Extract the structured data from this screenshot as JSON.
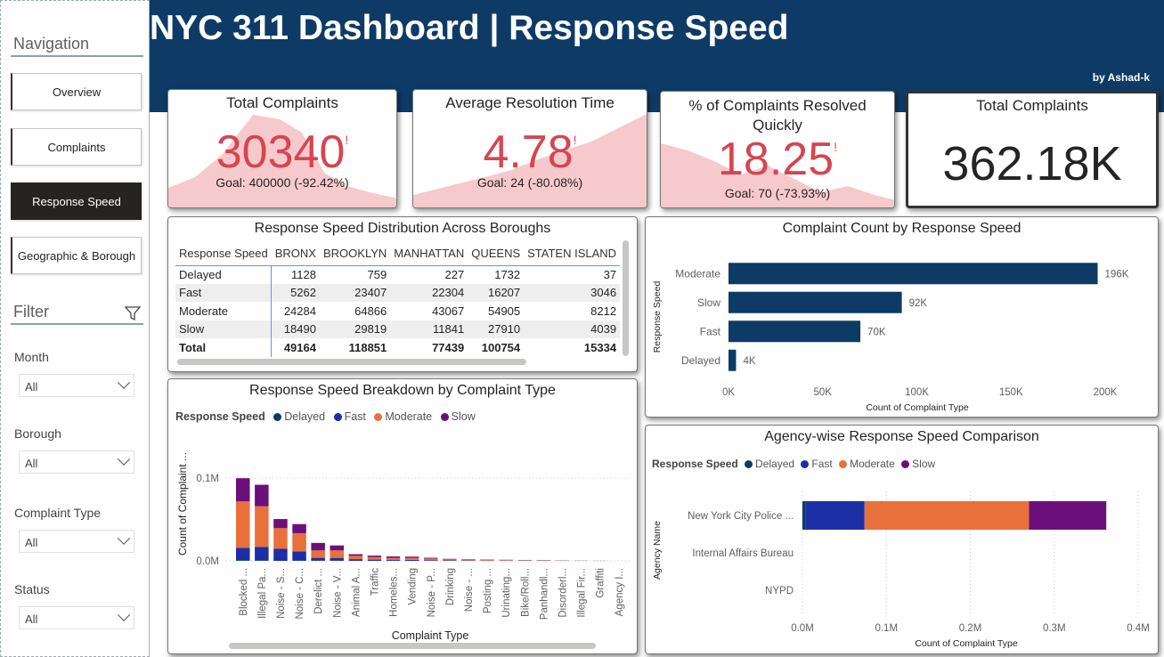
{
  "header": {
    "title": "NYC 311 Dashboard | Response Speed",
    "byline": "by Ashad-k"
  },
  "sidebar": {
    "navigation_heading": "Navigation",
    "nav_items": [
      {
        "label": "Overview",
        "active": false
      },
      {
        "label": "Complaints",
        "active": false
      },
      {
        "label": "Response Speed",
        "active": true
      },
      {
        "label": "Geographic & Borough",
        "active": false
      }
    ],
    "filter_heading": "Filter",
    "filters": [
      {
        "label": "Month",
        "value": "All"
      },
      {
        "label": "Borough",
        "value": "All"
      },
      {
        "label": "Complaint Type",
        "value": "All"
      },
      {
        "label": "Status",
        "value": "All"
      }
    ]
  },
  "kpis": [
    {
      "title": "Total Complaints",
      "value": "30340",
      "indicator": "!",
      "goal": "Goal: 400000 (-92.42%)"
    },
    {
      "title": "Average Resolution Time",
      "value": "4.78",
      "indicator": "!",
      "goal": "Goal: 24 (-80.08%)"
    },
    {
      "title": "% of Complaints Resolved Quickly",
      "value": "18.25",
      "indicator": "!",
      "goal": "Goal: 70 (-73.93%)"
    },
    {
      "title": "Total Complaints",
      "value": "362.18K"
    }
  ],
  "colors": {
    "header_bg": "#0d3b66",
    "kpi_value": "#d64550",
    "spark_fill": "#f6c9cc",
    "bar_navy": "#0d3b66",
    "delayed": "#0d3b66",
    "fast": "#1c2fa6",
    "moderate": "#e8703a",
    "slow": "#6b0f7a"
  },
  "matrix": {
    "title": "Response Speed Distribution Across Boroughs",
    "columns": [
      "Response Speed",
      "BRONX",
      "BROOKLYN",
      "MANHATTAN",
      "QUEENS",
      "STATEN ISLAND"
    ],
    "rows": [
      [
        "Delayed",
        "1128",
        "759",
        "227",
        "1732",
        "37"
      ],
      [
        "Fast",
        "5262",
        "23407",
        "22304",
        "16207",
        "3046"
      ],
      [
        "Moderate",
        "24284",
        "64866",
        "43067",
        "54905",
        "8212"
      ],
      [
        "Slow",
        "18490",
        "29819",
        "11841",
        "27910",
        "4039"
      ]
    ],
    "total": [
      "Total",
      "49164",
      "118851",
      "77439",
      "100754",
      "15334"
    ]
  },
  "legend": {
    "title": "Response Speed",
    "items": [
      "Delayed",
      "Fast",
      "Moderate",
      "Slow"
    ]
  },
  "chart_data": [
    {
      "type": "bar",
      "orientation": "horizontal",
      "title": "Complaint Count by Response Speed",
      "xlabel": "Count of Complaint Type",
      "ylabel": "Response Speed",
      "categories": [
        "Moderate",
        "Slow",
        "Fast",
        "Delayed"
      ],
      "values": [
        196000,
        92000,
        70000,
        4000
      ],
      "data_labels": [
        "196K",
        "92K",
        "70K",
        "4K"
      ],
      "xlim": [
        0,
        200000
      ],
      "xticks": [
        "0K",
        "50K",
        "100K",
        "150K",
        "200K"
      ]
    },
    {
      "type": "bar",
      "stacked": true,
      "title": "Response Speed Breakdown by Complaint Type",
      "xlabel": "Complaint Type",
      "ylabel": "Count of Complaint ...",
      "categories": [
        "Blocked ...",
        "Illegal Pa...",
        "Noise - S...",
        "Noise - C...",
        "Derelict ...",
        "Noise - V...",
        "Animal A...",
        "Traffic",
        "Homeles...",
        "Vending",
        "Noise - P...",
        "Drinking",
        "Noise - ...",
        "Posting ...",
        "Urinating...",
        "Bike/Roll...",
        "Panhandl...",
        "Disorderl...",
        "Illegal Fir...",
        "Graffiti",
        "Agency I..."
      ],
      "series": [
        {
          "name": "Delayed",
          "values": [
            800,
            900,
            500,
            400,
            150,
            100,
            50,
            20,
            20,
            20,
            10,
            10,
            5,
            5,
            5,
            5,
            5,
            3,
            2,
            1,
            1
          ]
        },
        {
          "name": "Fast",
          "values": [
            15000,
            16000,
            14000,
            11000,
            3500,
            3500,
            2000,
            1500,
            1000,
            1200,
            800,
            500,
            400,
            300,
            250,
            200,
            150,
            100,
            60,
            40,
            10
          ]
        },
        {
          "name": "Moderate",
          "values": [
            56000,
            49000,
            25000,
            22000,
            9000,
            9000,
            4000,
            3000,
            2500,
            2500,
            2000,
            1300,
            1000,
            800,
            700,
            600,
            500,
            350,
            250,
            150,
            20
          ]
        },
        {
          "name": "Slow",
          "values": [
            28000,
            26000,
            11000,
            11000,
            9000,
            6000,
            2000,
            1800,
            1800,
            1400,
            900,
            600,
            500,
            400,
            350,
            300,
            250,
            150,
            90,
            50,
            10
          ]
        }
      ],
      "yticks": [
        "0.0M",
        "0.1M"
      ],
      "ylim": [
        0,
        130000
      ]
    },
    {
      "type": "bar",
      "orientation": "horizontal",
      "stacked": true,
      "title": "Agency-wise Response Speed Comparison",
      "xlabel": "Count of Complaint Type",
      "ylabel": "Agency Name",
      "categories": [
        "New York City Police ...",
        "Internal Affairs Bureau",
        "NYPD"
      ],
      "series": [
        {
          "name": "Delayed",
          "values": [
            4000,
            0,
            0
          ]
        },
        {
          "name": "Fast",
          "values": [
            70000,
            0,
            0
          ]
        },
        {
          "name": "Moderate",
          "values": [
            196000,
            0,
            0
          ]
        },
        {
          "name": "Slow",
          "values": [
            92000,
            0,
            0
          ]
        }
      ],
      "xlim": [
        0,
        400000
      ],
      "xticks": [
        "0.0M",
        "0.1M",
        "0.2M",
        "0.3M",
        "0.4M"
      ]
    }
  ]
}
